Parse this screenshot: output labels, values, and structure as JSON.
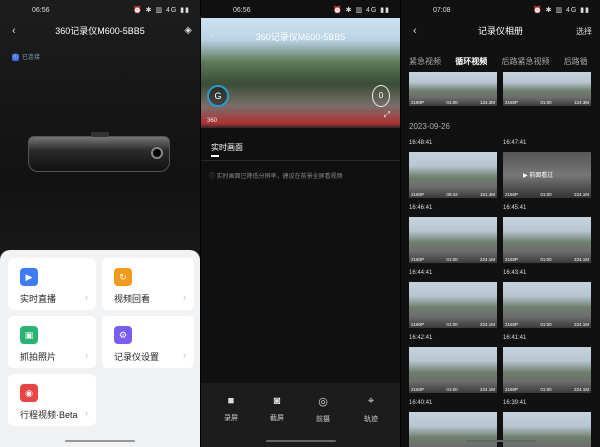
{
  "screen1": {
    "time": "06:56",
    "status_icons": "⏰ ✱ ▥ 4G ▮▮",
    "title": "360记录仪M600-5BB5",
    "connection": "已连接",
    "connection_badge": "ⓘ",
    "menu": [
      {
        "label": "实时直播",
        "icon": "live-icon",
        "color": "#3d7cf2",
        "glyph": "▶"
      },
      {
        "label": "视频回看",
        "icon": "playback-icon",
        "color": "#f39a1d",
        "glyph": "↻"
      },
      {
        "label": "抓拍照片",
        "icon": "photo-icon",
        "color": "#27b571",
        "glyph": "▣"
      },
      {
        "label": "记录仪设置",
        "icon": "settings-icon",
        "color": "#7b5cf0",
        "glyph": "⚙"
      },
      {
        "label": "行程视频·Beta",
        "icon": "trip-video-icon",
        "color": "#e84444",
        "glyph": "◉"
      }
    ]
  },
  "screen2": {
    "time": "06:56",
    "status_icons": "⏰ ✱ ▥ 4G ▮▮",
    "title": "360记录仪M600-5BB5",
    "gauge": "G",
    "brand": "360",
    "speed": "0",
    "tab": "实时画面",
    "note": "实时画面已降低分辨率，建议在前景全屏看视频",
    "tools": [
      {
        "label": "录屏",
        "icon": "record-icon",
        "glyph": "■"
      },
      {
        "label": "截屏",
        "icon": "camera-icon",
        "glyph": "◙"
      },
      {
        "label": "前摄",
        "icon": "front-camera-icon",
        "glyph": "◎"
      },
      {
        "label": "轨迹",
        "icon": "location-icon",
        "glyph": "⌖"
      }
    ]
  },
  "screen3": {
    "time": "07:08",
    "status_icons": "⏰ ✱ ▥ 4G ▮▮",
    "title": "记录仪相册",
    "select": "选择",
    "tabs": [
      "紧急视频",
      "循环视频",
      "后路紧急视频",
      "后路循"
    ],
    "active_tab": 1,
    "top_thumbs": [
      {
        "res": "2160P",
        "dur": "01:00",
        "size": "124.3M"
      },
      {
        "res": "2160P",
        "dur": "01:00",
        "size": "124.3M"
      }
    ],
    "date": "2023-09-26",
    "clips": [
      {
        "time": "16:48:41",
        "res": "2160P",
        "dur": "00:42",
        "size": "151.4M"
      },
      {
        "time": "16:47:41",
        "res": "2160P",
        "dur": "01:00",
        "size": "224.1M",
        "overlay": "▶ 前面看过"
      },
      {
        "time": "16:46:41",
        "res": "2160P",
        "dur": "01:00",
        "size": "224.1M"
      },
      {
        "time": "16:45:41",
        "res": "2160P",
        "dur": "01:00",
        "size": "224.1M"
      },
      {
        "time": "16:44:41",
        "res": "2160P",
        "dur": "01:00",
        "size": "224.1M"
      },
      {
        "time": "16:43:41",
        "res": "2160P",
        "dur": "01:00",
        "size": "224.1M"
      },
      {
        "time": "16:42:41",
        "res": "2160P",
        "dur": "01:00",
        "size": "224.1M"
      },
      {
        "time": "16:41:41",
        "res": "2160P",
        "dur": "01:00",
        "size": "224.1M"
      },
      {
        "time": "16:40:41",
        "res": "",
        "dur": "",
        "size": ""
      },
      {
        "time": "16:39:41",
        "res": "",
        "dur": "",
        "size": ""
      }
    ]
  }
}
